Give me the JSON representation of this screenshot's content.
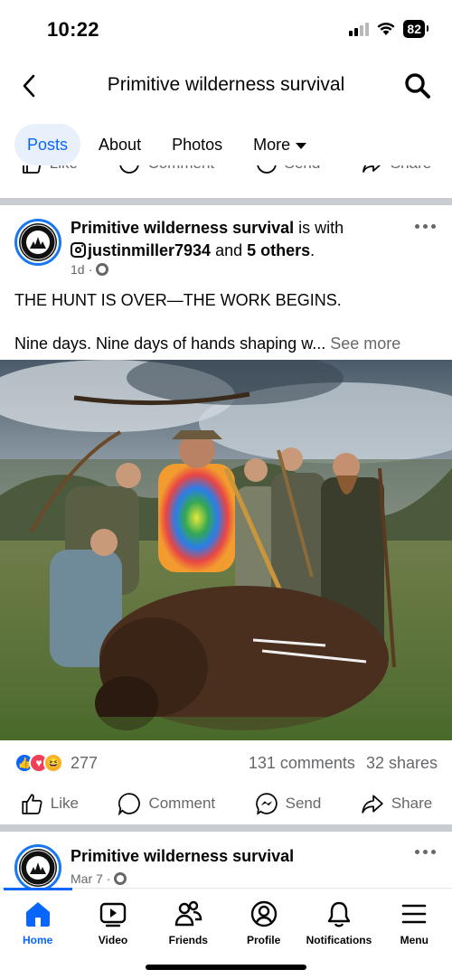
{
  "status": {
    "time": "10:22",
    "battery": "82"
  },
  "header": {
    "title": "Primitive wilderness survival"
  },
  "tabs": [
    {
      "label": "Posts",
      "active": true
    },
    {
      "label": "About",
      "active": false
    },
    {
      "label": "Photos",
      "active": false
    },
    {
      "label": "More",
      "active": false
    }
  ],
  "prev_actions": {
    "like": "Like",
    "comment": "Comment",
    "send": "Send",
    "share": "Share"
  },
  "post": {
    "author": "Primitive wilderness survival",
    "with_text": " is with ",
    "tagged_user": "justinmiller7934",
    "and_text": " and ",
    "others": "5 others",
    "period": ".",
    "time": "1d",
    "line1": "THE HUNT IS OVER—THE WORK BEGINS.",
    "line2": "Nine days. Nine days of hands shaping w...",
    "see_more": "See more",
    "reaction_count": "277",
    "comments": "131 comments",
    "shares": "32 shares",
    "actions": {
      "like": "Like",
      "comment": "Comment",
      "send": "Send",
      "share": "Share"
    }
  },
  "next_post": {
    "author": "Primitive wilderness survival",
    "time": "Mar 7"
  },
  "nav": [
    {
      "label": "Home",
      "icon": "home-icon",
      "active": true
    },
    {
      "label": "Video",
      "icon": "video-icon",
      "active": false
    },
    {
      "label": "Friends",
      "icon": "friends-icon",
      "active": false
    },
    {
      "label": "Profile",
      "icon": "profile-icon",
      "active": false
    },
    {
      "label": "Notifications",
      "icon": "bell-icon",
      "active": false
    },
    {
      "label": "Menu",
      "icon": "menu-icon",
      "active": false
    }
  ],
  "colors": {
    "accent": "#0866ff",
    "secondary_text": "#65676b",
    "divider": "#c9ccd1"
  }
}
